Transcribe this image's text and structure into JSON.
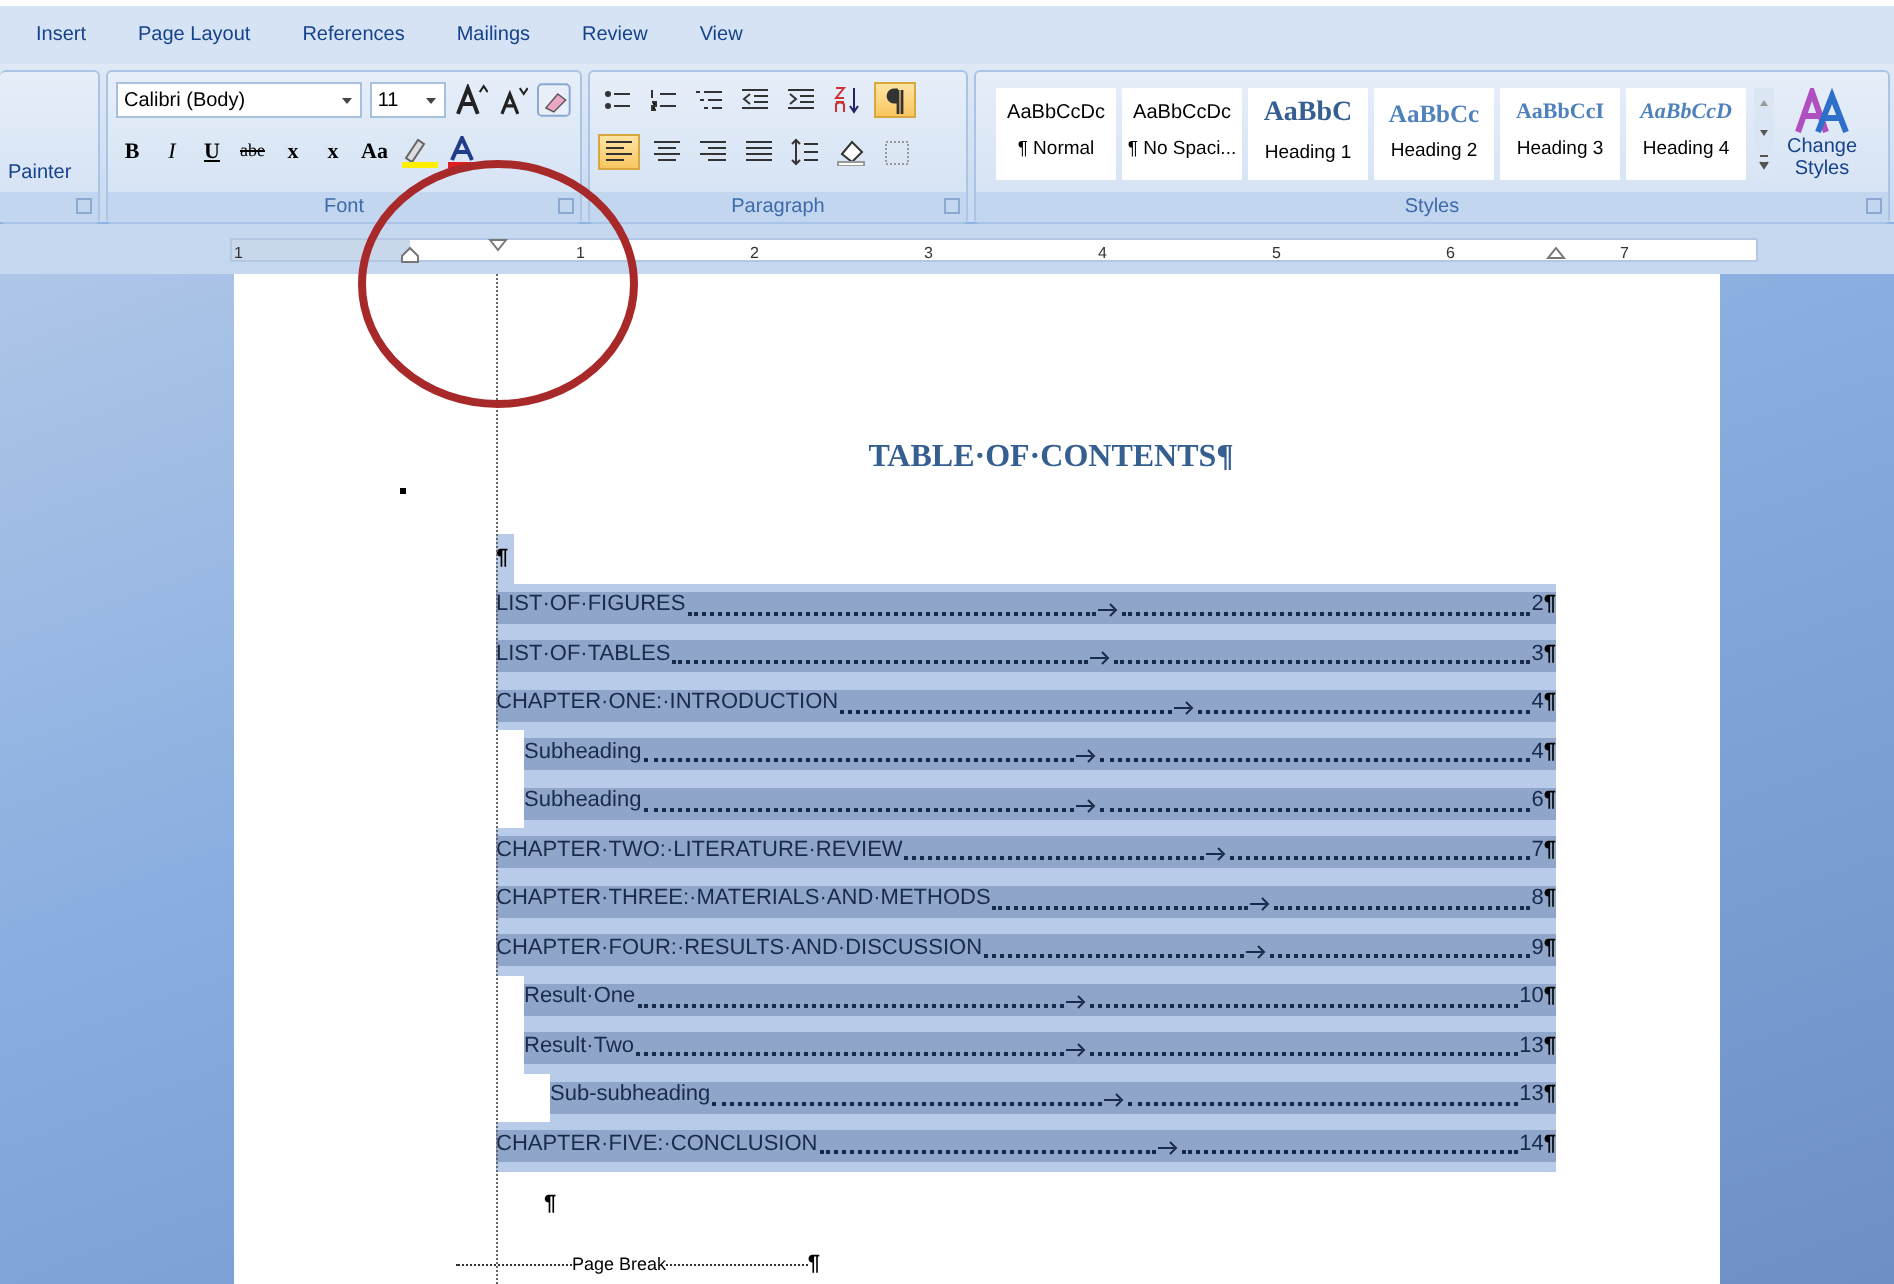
{
  "ribbon_tabs": [
    {
      "label": "Insert",
      "selected": false
    },
    {
      "label": "Page Layout",
      "selected": false
    },
    {
      "label": "References",
      "selected": false
    },
    {
      "label": "Mailings",
      "selected": false
    },
    {
      "label": "Review",
      "selected": false
    },
    {
      "label": "View",
      "selected": false
    }
  ],
  "clipboard": {
    "label": "Painter"
  },
  "font_group": {
    "title": "Font",
    "font_name": "Calibri (Body)",
    "font_size": "11",
    "format_buttons": [
      {
        "label": "B",
        "kind": "bold"
      },
      {
        "label": "I",
        "kind": "italic"
      },
      {
        "label": "U",
        "kind": "underline"
      },
      {
        "label": "abe",
        "kind": "strike"
      },
      {
        "label": "x",
        "kind": "subscript"
      },
      {
        "label": "x",
        "kind": "superscript"
      },
      {
        "label": "Aa",
        "kind": "case"
      }
    ]
  },
  "paragraph_group": {
    "title": "Paragraph",
    "buttons": [
      {
        "kind": "bullets",
        "on": false
      },
      {
        "kind": "numbering",
        "on": false
      },
      {
        "kind": "multilevel",
        "on": false
      },
      {
        "kind": "outdent",
        "on": false
      },
      {
        "kind": "indent",
        "on": false
      },
      {
        "kind": "sort",
        "on": false
      },
      {
        "kind": "marks",
        "on": true
      },
      {
        "kind": "align-left",
        "on": true
      },
      {
        "kind": "center",
        "on": false
      },
      {
        "kind": "align-right",
        "on": false
      },
      {
        "kind": "justify",
        "on": false
      },
      {
        "kind": "spacing",
        "on": false
      },
      {
        "kind": "shading",
        "on": false
      },
      {
        "kind": "borders",
        "on": false
      }
    ]
  },
  "styles_group": {
    "title": "Styles",
    "items": [
      {
        "preview": "AaBbCcDc",
        "name": "¶ Normal",
        "kind": "normal"
      },
      {
        "preview": "AaBbCcDc",
        "name": "¶ No Spaci...",
        "kind": "normal"
      },
      {
        "preview": "AaBbC",
        "name": "Heading 1",
        "kind": "heading1"
      },
      {
        "preview": "AaBbCc",
        "name": "Heading 2",
        "kind": "heading2"
      },
      {
        "preview": "AaBbCcI",
        "name": "Heading 3",
        "kind": "heading3"
      },
      {
        "preview": "AaBbCcD",
        "name": "Heading 4",
        "kind": "heading4"
      }
    ],
    "change_styles": "Change Styles"
  },
  "ruler_labels": [
    "1",
    "1",
    "2",
    "3",
    "4",
    "5",
    "6",
    "7"
  ],
  "document": {
    "title": "TABLE·OF·CONTENTS¶",
    "blank_mark": "¶",
    "toc": [
      {
        "title": "LIST·OF·FIGURES",
        "page": "2",
        "mark": "¶",
        "selected": true
      },
      {
        "title": "LIST·OF·TABLES",
        "page": "3",
        "mark": "¶",
        "selected": true
      },
      {
        "title": "CHAPTER·ONE:·INTRODUCTION",
        "page": "4",
        "mark": "¶",
        "selected": true,
        "children": [
          {
            "title": "Subheading",
            "page": "4",
            "mark": "¶",
            "selected": true
          },
          {
            "title": "Subheading",
            "page": "6",
            "mark": "¶",
            "selected": true
          }
        ]
      },
      {
        "title": "CHAPTER·TWO:·LITERATURE·REVIEW",
        "page": "7",
        "mark": "¶",
        "selected": true
      },
      {
        "title": "CHAPTER·THREE:·MATERIALS·AND·METHODS",
        "page": "8",
        "mark": "¶",
        "selected": true
      },
      {
        "title": "CHAPTER·FOUR:·RESULTS·AND·DISCUSSION",
        "page": "9",
        "mark": "¶",
        "selected": true,
        "children": [
          {
            "title": "Result·One",
            "page": "10",
            "mark": "¶",
            "selected": true
          },
          {
            "title": "Result·Two",
            "page": "13",
            "mark": "¶",
            "selected": true,
            "children": [
              {
                "title": "Sub-subheading",
                "page": "13",
                "mark": "¶",
                "selected": true
              }
            ]
          }
        ]
      },
      {
        "title": "CHAPTER·FIVE:·CONCLUSION",
        "page": "14",
        "mark": "¶",
        "selected": true
      }
    ],
    "after_mark": "¶",
    "page_break": "Page Break",
    "page_break_mark": "¶"
  }
}
